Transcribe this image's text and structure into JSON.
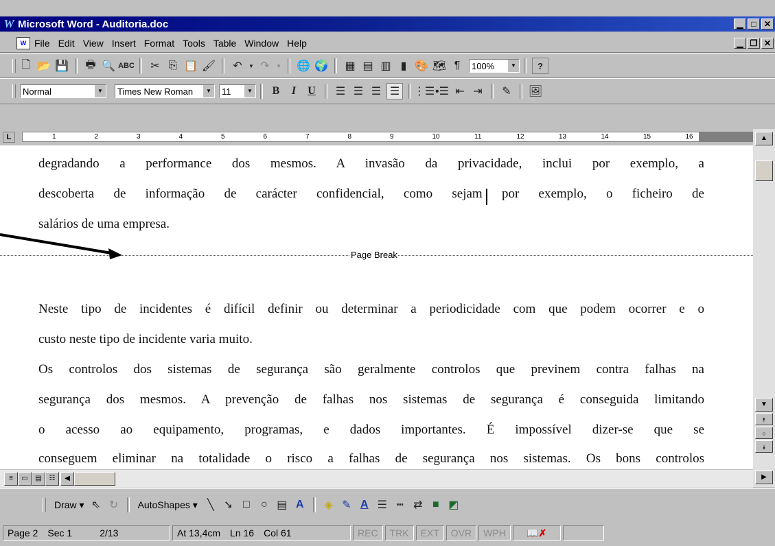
{
  "window": {
    "title": "Microsoft Word - Auditoria.doc",
    "icon": "word-logo",
    "controls": [
      "_",
      "□",
      "×"
    ],
    "doc_controls": [
      "_",
      "🗗",
      "×"
    ]
  },
  "menu": [
    "File",
    "Edit",
    "View",
    "Insert",
    "Format",
    "Tools",
    "Table",
    "Window",
    "Help"
  ],
  "standard_toolbar": {
    "zoom": "100%",
    "help_label": "?"
  },
  "formatting_toolbar": {
    "style": "Normal",
    "font": "Times New Roman",
    "size": "11",
    "bold": "B",
    "italic": "I",
    "underline": "U"
  },
  "ruler": {
    "tab_selector": "L",
    "numbers": [
      "1",
      "2",
      "3",
      "4",
      "5",
      "6",
      "7",
      "8",
      "9",
      "10",
      "11",
      "12",
      "13",
      "14",
      "15",
      "16"
    ]
  },
  "document": {
    "lines_page1": [
      "degradando  a performance dos mesmos. A invasão da privacidade, inclui por exemplo, a",
      "descoberta de informação de carácter confidencial, como sejam por exemplo, o ficheiro de",
      "salários de uma empresa."
    ],
    "page_break_label": "Page Break",
    "lines_page2": [
      "Neste tipo de incidentes é difícil definir ou determinar a periodicidade com que podem ocorrer e o",
      "custo neste tipo de incidente varia muito.",
      "Os controlos dos sistemas de segurança são geralmente controlos que previnem contra falhas na",
      "segurança dos mesmos. A prevenção de falhas nos sistemas de segurança é conseguida limitando",
      "o acesso ao equipamento, programas, e dados importantes. É impossível dizer-se que se",
      "conseguem eliminar na totalidade o risco a falhas de segurança nos sistemas. Os bons controlos"
    ]
  },
  "draw_toolbar": {
    "draw": "Draw",
    "autoshapes": "AutoShapes"
  },
  "status": {
    "page": "Page 2",
    "section": "Sec 1",
    "pages": "2/13",
    "at": "At 13,4cm",
    "line": "Ln 16",
    "col": "Col 61",
    "modes": [
      "REC",
      "TRK",
      "EXT",
      "OVR",
      "WPH"
    ]
  }
}
